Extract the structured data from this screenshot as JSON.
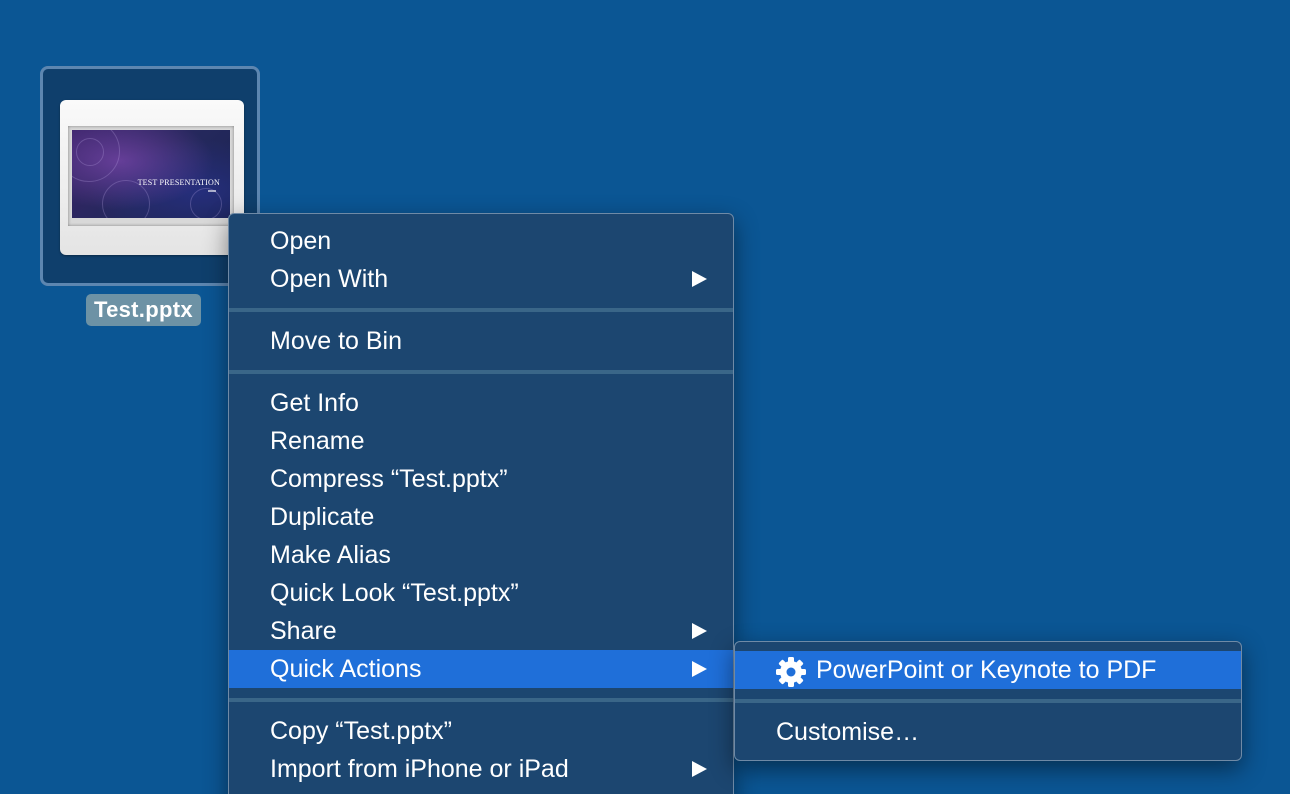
{
  "desktop": {
    "file": {
      "name": "Test.pptx",
      "thumbnail_title": "TEST PRESENTATION"
    }
  },
  "context_menu": {
    "groups": [
      [
        {
          "label": "Open",
          "submenu": false
        },
        {
          "label": "Open With",
          "submenu": true
        }
      ],
      [
        {
          "label": "Move to Bin",
          "submenu": false
        }
      ],
      [
        {
          "label": "Get Info",
          "submenu": false
        },
        {
          "label": "Rename",
          "submenu": false
        },
        {
          "label": "Compress “Test.pptx”",
          "submenu": false
        },
        {
          "label": "Duplicate",
          "submenu": false
        },
        {
          "label": "Make Alias",
          "submenu": false
        },
        {
          "label": "Quick Look “Test.pptx”",
          "submenu": false
        },
        {
          "label": "Share",
          "submenu": true
        },
        {
          "label": "Quick Actions",
          "submenu": true,
          "highlighted": true
        }
      ],
      [
        {
          "label": "Copy “Test.pptx”",
          "submenu": false
        },
        {
          "label": "Import from iPhone or iPad",
          "submenu": true
        }
      ]
    ]
  },
  "quick_actions_submenu": {
    "items": [
      {
        "label": "PowerPoint or Keynote to PDF",
        "icon": "gear-icon",
        "highlighted": true
      },
      {
        "label": "Customise…"
      }
    ]
  },
  "colors": {
    "desktop_background": "#0b5694",
    "menu_background": "#1c4670",
    "highlight": "#1f6fd9",
    "file_label_background": "#6d92a5"
  }
}
